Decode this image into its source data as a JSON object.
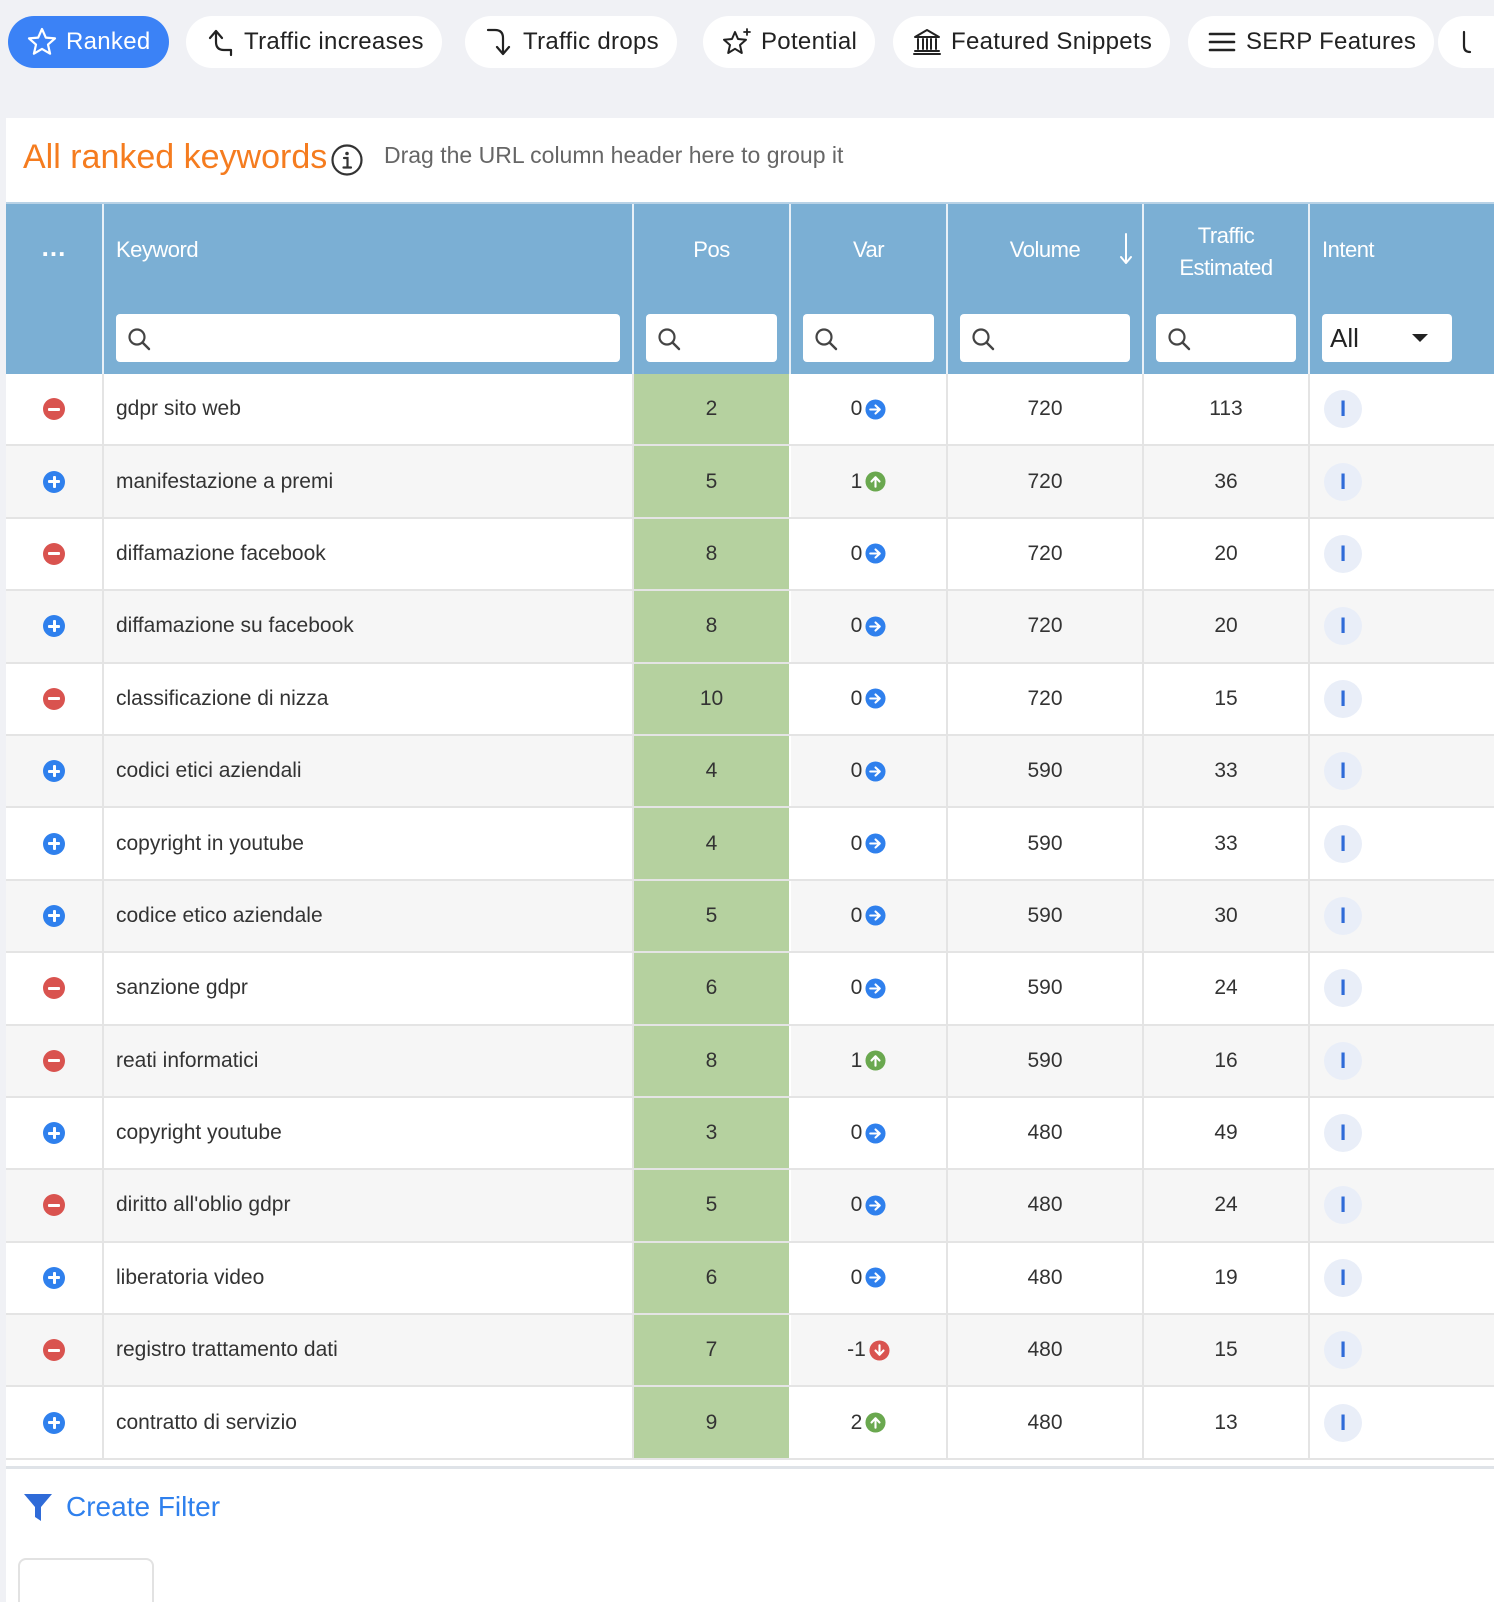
{
  "tabs": [
    {
      "label": "Ranked",
      "icon": "star-icon",
      "active": true
    },
    {
      "label": "Traffic increases",
      "icon": "trend-up-arrow-icon",
      "active": false
    },
    {
      "label": "Traffic drops",
      "icon": "trend-down-arrow-icon",
      "active": false
    },
    {
      "label": "Potential",
      "icon": "sparkle-star-icon",
      "active": false
    },
    {
      "label": "Featured Snippets",
      "icon": "bank-building-icon",
      "active": false
    },
    {
      "label": "SERP Features",
      "icon": "menu-lines-icon",
      "active": false
    }
  ],
  "panel": {
    "title": "All ranked keywords",
    "drag_hint": "Drag the URL column header here to group it"
  },
  "grid": {
    "columns": {
      "more": "...",
      "keyword": "Keyword",
      "pos": "Pos",
      "var": "Var",
      "volume": "Volume",
      "traffic_line1": "Traffic",
      "traffic_line2": "Estimated",
      "intent": "Intent"
    },
    "intent_filter_value": "All",
    "sort": {
      "column": "Volume",
      "direction": "descending"
    },
    "rows": [
      {
        "toggle": "minus",
        "keyword": "gdpr sito web",
        "pos": "2",
        "var": "0",
        "trend": "same",
        "volume": "720",
        "traffic": "113",
        "intent": "I"
      },
      {
        "toggle": "plus",
        "keyword": "manifestazione a premi",
        "pos": "5",
        "var": "1",
        "trend": "up",
        "volume": "720",
        "traffic": "36",
        "intent": "I"
      },
      {
        "toggle": "minus",
        "keyword": "diffamazione facebook",
        "pos": "8",
        "var": "0",
        "trend": "same",
        "volume": "720",
        "traffic": "20",
        "intent": "I"
      },
      {
        "toggle": "plus",
        "keyword": "diffamazione su facebook",
        "pos": "8",
        "var": "0",
        "trend": "same",
        "volume": "720",
        "traffic": "20",
        "intent": "I"
      },
      {
        "toggle": "minus",
        "keyword": "classificazione di nizza",
        "pos": "10",
        "var": "0",
        "trend": "same",
        "volume": "720",
        "traffic": "15",
        "intent": "I"
      },
      {
        "toggle": "plus",
        "keyword": "codici etici aziendali",
        "pos": "4",
        "var": "0",
        "trend": "same",
        "volume": "590",
        "traffic": "33",
        "intent": "I"
      },
      {
        "toggle": "plus",
        "keyword": "copyright in youtube",
        "pos": "4",
        "var": "0",
        "trend": "same",
        "volume": "590",
        "traffic": "33",
        "intent": "I"
      },
      {
        "toggle": "plus",
        "keyword": "codice etico aziendale",
        "pos": "5",
        "var": "0",
        "trend": "same",
        "volume": "590",
        "traffic": "30",
        "intent": "I"
      },
      {
        "toggle": "minus",
        "keyword": "sanzione gdpr",
        "pos": "6",
        "var": "0",
        "trend": "same",
        "volume": "590",
        "traffic": "24",
        "intent": "I"
      },
      {
        "toggle": "minus",
        "keyword": "reati informatici",
        "pos": "8",
        "var": "1",
        "trend": "up",
        "volume": "590",
        "traffic": "16",
        "intent": "I"
      },
      {
        "toggle": "plus",
        "keyword": "copyright youtube",
        "pos": "3",
        "var": "0",
        "trend": "same",
        "volume": "480",
        "traffic": "49",
        "intent": "I"
      },
      {
        "toggle": "minus",
        "keyword": "diritto all'oblio gdpr",
        "pos": "5",
        "var": "0",
        "trend": "same",
        "volume": "480",
        "traffic": "24",
        "intent": "I"
      },
      {
        "toggle": "plus",
        "keyword": "liberatoria video",
        "pos": "6",
        "var": "0",
        "trend": "same",
        "volume": "480",
        "traffic": "19",
        "intent": "I"
      },
      {
        "toggle": "minus",
        "keyword": "registro trattamento dati",
        "pos": "7",
        "var": "-1",
        "trend": "down",
        "volume": "480",
        "traffic": "15",
        "intent": "I"
      },
      {
        "toggle": "plus",
        "keyword": "contratto di servizio",
        "pos": "9",
        "var": "2",
        "trend": "up",
        "volume": "480",
        "traffic": "13",
        "intent": "I"
      }
    ]
  },
  "footer": {
    "create_filter_label": "Create Filter"
  },
  "colors": {
    "accent": "#3b82f6",
    "title_orange": "#f57c1f",
    "header_blue": "#7bafd4",
    "pos_green": "#b5d19f",
    "trend_same": "#2f80ed",
    "trend_up": "#6aa84f",
    "trend_down": "#d9534f"
  }
}
